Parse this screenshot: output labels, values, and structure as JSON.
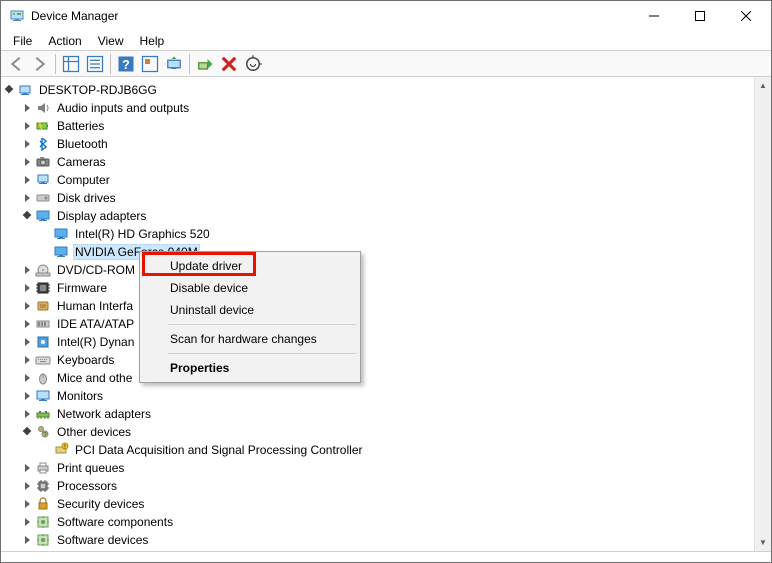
{
  "window_title": "Device Manager",
  "menus": {
    "file": "File",
    "action": "Action",
    "view": "View",
    "help": "Help"
  },
  "tree": {
    "root": "DESKTOP-RDJB6GG",
    "items": [
      {
        "label": "Audio inputs and outputs",
        "icon": "audio"
      },
      {
        "label": "Batteries",
        "icon": "battery"
      },
      {
        "label": "Bluetooth",
        "icon": "bluetooth"
      },
      {
        "label": "Cameras",
        "icon": "camera"
      },
      {
        "label": "Computer",
        "icon": "computer"
      },
      {
        "label": "Disk drives",
        "icon": "disk"
      },
      {
        "label": "Display adapters",
        "icon": "display",
        "expanded": true,
        "children": [
          {
            "label": "Intel(R) HD Graphics 520",
            "icon": "display"
          },
          {
            "label": "NVIDIA GeForce 940M",
            "icon": "display",
            "selected": true
          }
        ]
      },
      {
        "label": "DVD/CD-ROM",
        "icon": "dvd"
      },
      {
        "label": "Firmware",
        "icon": "firmware"
      },
      {
        "label": "Human Interfa",
        "icon": "hid"
      },
      {
        "label": "IDE ATA/ATAP",
        "icon": "ide"
      },
      {
        "label": "Intel(R) Dynan",
        "icon": "intel"
      },
      {
        "label": "Keyboards",
        "icon": "keyboard"
      },
      {
        "label": "Mice and othe",
        "icon": "mouse"
      },
      {
        "label": "Monitors",
        "icon": "monitor"
      },
      {
        "label": "Network adapters",
        "icon": "network"
      },
      {
        "label": "Other devices",
        "icon": "other",
        "expanded": true,
        "children": [
          {
            "label": "PCI Data Acquisition and Signal Processing Controller",
            "icon": "otherdev"
          }
        ]
      },
      {
        "label": "Print queues",
        "icon": "printer"
      },
      {
        "label": "Processors",
        "icon": "processor"
      },
      {
        "label": "Security devices",
        "icon": "security"
      },
      {
        "label": "Software components",
        "icon": "software"
      },
      {
        "label": "Software devices",
        "icon": "software"
      }
    ]
  },
  "context_menu": {
    "update": "Update driver",
    "disable": "Disable device",
    "uninstall": "Uninstall device",
    "scan": "Scan for hardware changes",
    "properties": "Properties"
  }
}
